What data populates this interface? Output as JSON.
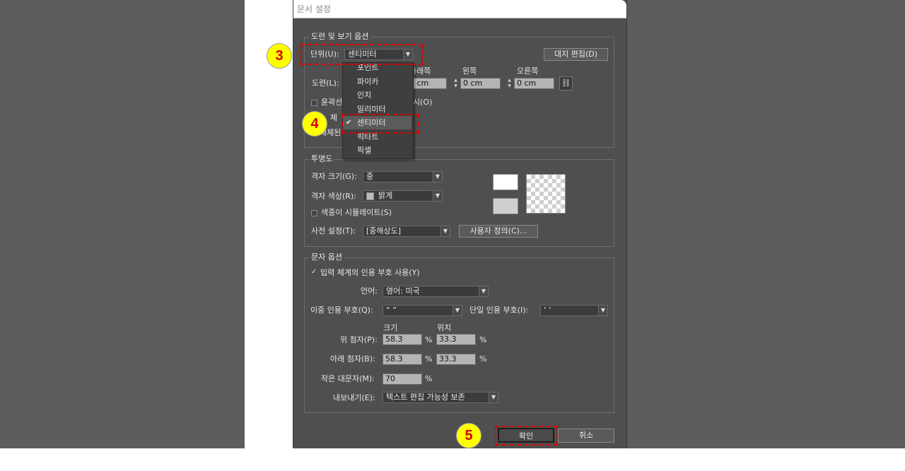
{
  "dialog": {
    "title": "문서 설정"
  },
  "guides": {
    "legend": "도련 및 보기 옵션",
    "units_label": "단위(U):",
    "units_value": "센티미터",
    "edit_paste_button": "대지 편집(D)",
    "bleed_label": "도련(L):",
    "col_bottom": "아래쪽",
    "col_left": "왼쪽",
    "col_right": "오른쪽",
    "bottom_value": "0 cm",
    "left_value": "0 cm",
    "right_value": "0 cm",
    "outline_label": "윤곽선",
    "outline_suffix": "시(O)",
    "row_a_partial": "체",
    "row_b_partial": "대체된"
  },
  "units_menu": {
    "items": [
      "포인트",
      "파이카",
      "인치",
      "밀리미터",
      "센티미터",
      "픽셀",
      "픽셀"
    ],
    "items_visible": [
      "포인트",
      "파이카",
      "인치",
      "밀리미터",
      "센티미터",
      "픽셀"
    ],
    "hidden_partial": "픽타트",
    "selected": "센티미터"
  },
  "transparency": {
    "legend": "투명도",
    "grid_size_label": "격자 크기(G):",
    "grid_size_value": "중",
    "grid_color_label": "격자 색상(R):",
    "grid_color_value": "밝게",
    "simulate_paper_label": "색종이 시뮬레이트(S)",
    "preset_label": "사전 설정(T):",
    "preset_value": "[중해상도]",
    "custom_button": "사용자 정의(C)..."
  },
  "type_options": {
    "legend": "문자 옵션",
    "typographer_quotes_label": "입력 체계의 인용 부호 사용(Y)",
    "language_label": "언어:",
    "language_value": "영어: 미국",
    "double_quotes_label": "이중 인용 부호(Q):",
    "double_quotes_value": "“ ”",
    "single_quotes_label": "단일 인용 부호(I):",
    "single_quotes_value": "‘ ’",
    "size_header": "크기",
    "position_header": "위치",
    "superscript_label": "위 첨자(P):",
    "superscript_size": "58.3",
    "superscript_position": "33.3",
    "subscript_label": "아래 첨자(B):",
    "subscript_size": "58.3",
    "subscript_position": "33.3",
    "small_caps_label": "작은 대문자(M):",
    "small_caps_value": "70",
    "percent": "%",
    "export_label": "내보내기(E):",
    "export_value": "텍스트 편집 가능성 보존"
  },
  "buttons": {
    "ok": "확인",
    "cancel": "취소"
  },
  "callouts": {
    "c3": "3",
    "c4": "4",
    "c5": "5"
  },
  "colors": {
    "dialog_bg": "#4f4f4f",
    "highlight": "#e00000",
    "callout_fill": "#ffff00",
    "callout_text": "#d40000"
  }
}
